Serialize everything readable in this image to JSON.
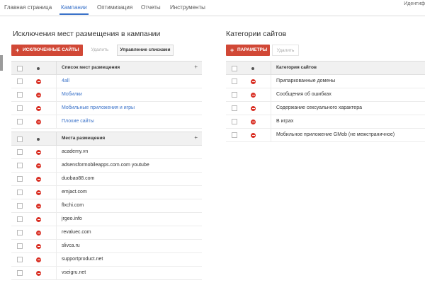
{
  "nav": {
    "items": [
      "Главная страница",
      "Кампании",
      "Оптимизация",
      "Отчеты",
      "Инструменты"
    ],
    "active_index": 1,
    "right_text": "Идентиф"
  },
  "left_panel": {
    "title": "Исключения мест размещения в кампании",
    "add_button": "ИСКЛЮЧЕННЫЕ САЙТЫ",
    "remove_button": "Удалить",
    "manage_button": "Управление списками",
    "lists_table": {
      "header": "Список мест размещения",
      "rows": [
        "4all",
        "Мобилки",
        "Мобильные приложения и игры",
        "Плохие сайты"
      ]
    },
    "placements_table": {
      "header": "Места размещения",
      "rows": [
        "academy.vn",
        "adsensformobileapps.com.com youtube",
        "duobao88.com",
        "emjact.com",
        "flxchi.com",
        "jrgeo.info",
        "revaluec.com",
        "slivca.ru",
        "supportproduct.net",
        "vseigru.net"
      ]
    }
  },
  "right_panel": {
    "title": "Категории сайтов",
    "add_button": "ПАРАМЕТРЫ",
    "remove_button": "Удалить",
    "categories_table": {
      "header": "Категория сайтов",
      "rows": [
        "Припаркованные домены",
        "Сообщения об ошибках",
        "Содержание сексуального характера",
        "В играх",
        "Мобильное приложение GMob (не межстраничное)"
      ]
    }
  },
  "colors": {
    "accent": "#3a72c9",
    "brand_red": "#d14836",
    "status_red": "#d93025"
  },
  "icons": {
    "add": "plus-icon",
    "status": "excluded-status-icon",
    "sort": "sort-arrow-icon"
  }
}
